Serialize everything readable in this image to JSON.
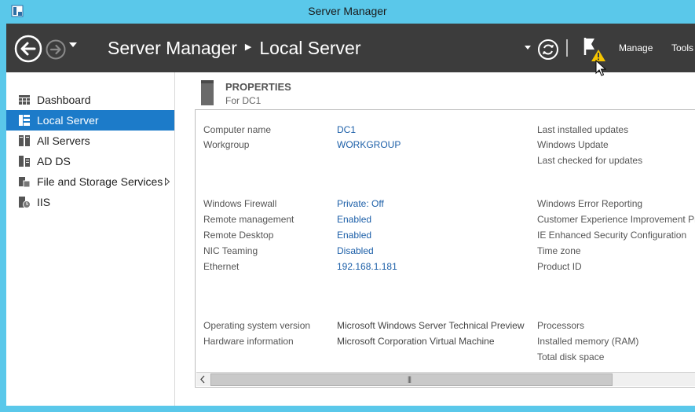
{
  "window": {
    "title": "Server Manager"
  },
  "header": {
    "breadcrumb_root": "Server Manager",
    "breadcrumb_current": "Local Server",
    "menu_manage": "Manage",
    "menu_tools": "Tools",
    "notification_status": "warning"
  },
  "sidebar": {
    "items": [
      {
        "label": "Dashboard",
        "icon": "dashboard-icon"
      },
      {
        "label": "Local Server",
        "icon": "local-server-icon",
        "selected": true
      },
      {
        "label": "All Servers",
        "icon": "all-servers-icon"
      },
      {
        "label": "AD DS",
        "icon": "ad-ds-icon"
      },
      {
        "label": "File and Storage Services",
        "icon": "file-storage-icon",
        "has_submenu": true
      },
      {
        "label": "IIS",
        "icon": "iis-icon"
      }
    ]
  },
  "properties": {
    "title": "PROPERTIES",
    "subtitle": "For DC1",
    "col1": [
      {
        "label": "Computer name",
        "value": "DC1"
      },
      {
        "label": "Workgroup",
        "value": "WORKGROUP"
      },
      {
        "label": "Windows Firewall",
        "value": "Private: Off"
      },
      {
        "label": "Remote management",
        "value": "Enabled"
      },
      {
        "label": "Remote Desktop",
        "value": "Enabled"
      },
      {
        "label": "NIC Teaming",
        "value": "Disabled"
      },
      {
        "label": "Ethernet",
        "value": "192.168.1.181"
      },
      {
        "label": "Operating system version",
        "value": "Microsoft Windows Server Technical Preview"
      },
      {
        "label": "Hardware information",
        "value": "Microsoft Corporation Virtual Machine"
      }
    ],
    "col2": [
      "Last installed updates",
      "Windows Update",
      "Last checked for updates",
      "Windows Error Reporting",
      "Customer Experience Improvement Pr",
      "IE Enhanced Security Configuration",
      "Time zone",
      "Product ID",
      "Processors",
      "Installed memory (RAM)",
      "Total disk space"
    ]
  },
  "colors": {
    "titlebar": "#5ac8ea",
    "header": "#3c3c3c",
    "selection": "#1c7bc9",
    "link": "#1c5fa8",
    "warning": "#f5c400"
  }
}
